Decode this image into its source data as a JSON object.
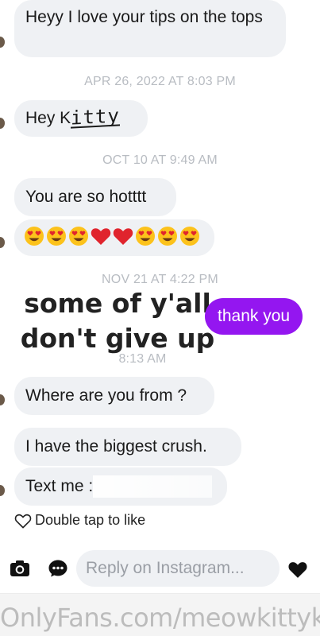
{
  "messages": {
    "m1": "Heyy I love your tips on the tops",
    "ts1": "APR 26, 2022 AT 8:03 PM",
    "m2_prefix": "Hey K",
    "m2_hand": "itty",
    "ts2": "OCT 10 AT 9:49 AM",
    "m3": "You are so hotttt",
    "ts3": "NOV 21 AT 4:22 PM",
    "ts4": "8:13 AM",
    "m5": "Where are you from ?",
    "m6": "I have the biggest crush.",
    "m7": "Text me :"
  },
  "emoji_row": [
    "heart-eyes",
    "heart-eyes",
    "heart-eyes",
    "red-heart",
    "red-heart",
    "heart-eyes",
    "heart-eyes",
    "heart-eyes"
  ],
  "overlay": {
    "line1": "some of y'all",
    "line2": "don't give up",
    "reply": "thank you",
    "reply_color": "#9416f0"
  },
  "like_hint": "Double tap to like",
  "composer": {
    "placeholder": "Reply on Instagram...",
    "icons": [
      "camera-icon",
      "chat-icon",
      "heart-icon"
    ]
  },
  "watermark": "OnlyFans.com/meowkittykat"
}
